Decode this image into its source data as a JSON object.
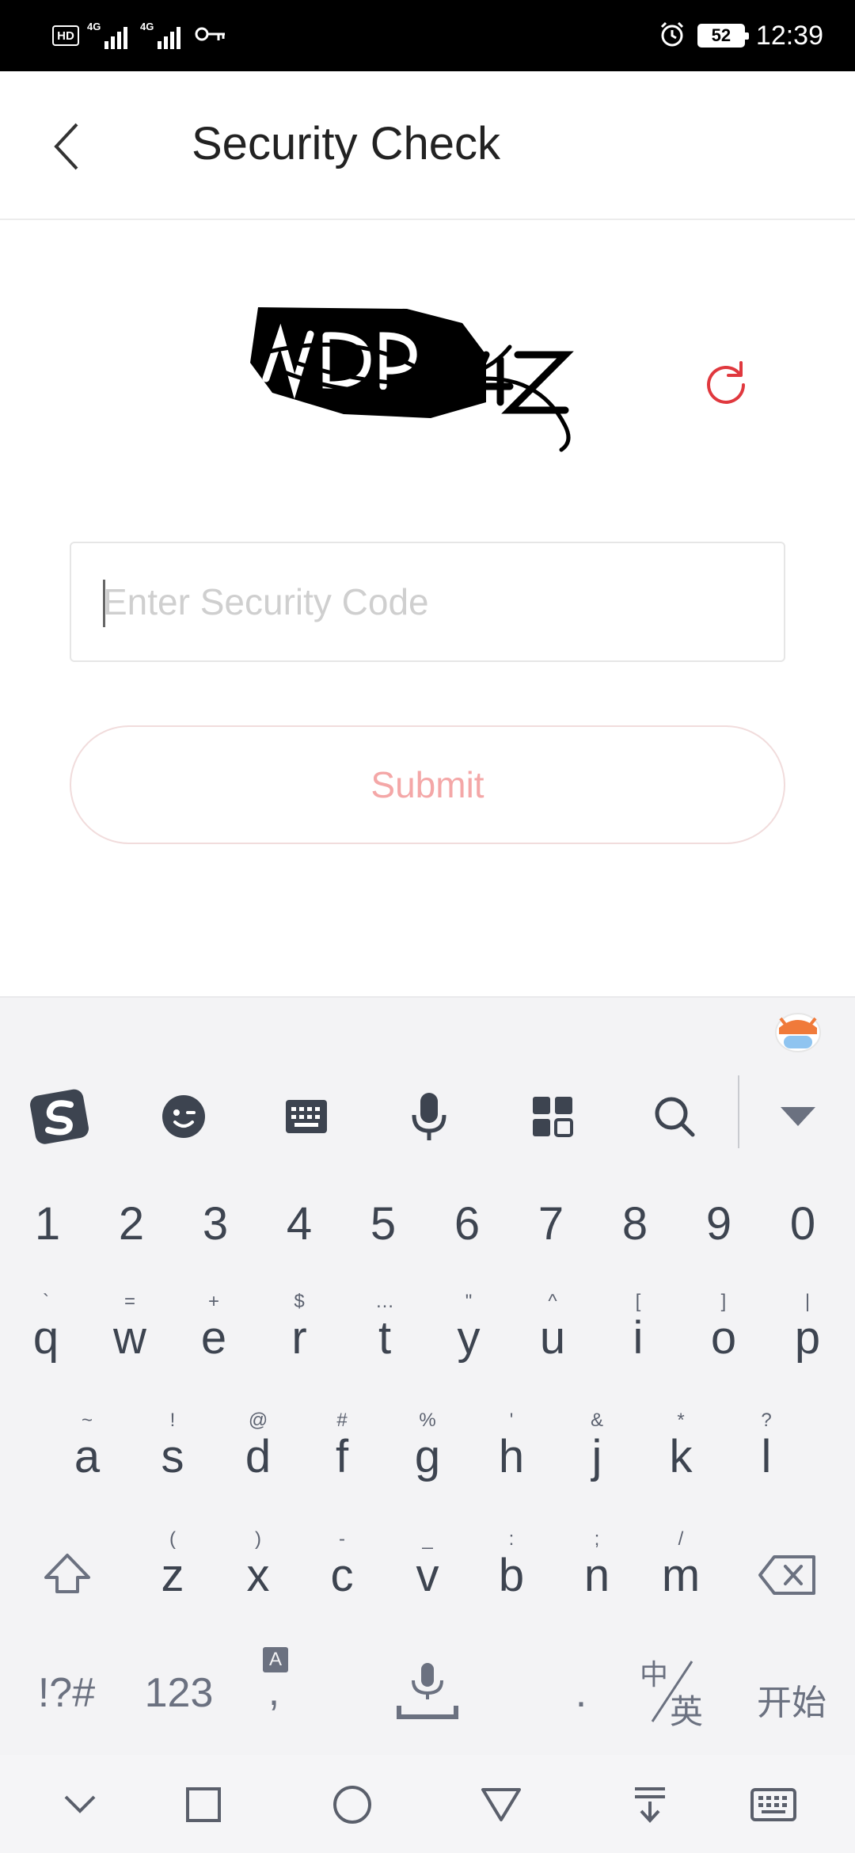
{
  "status_bar": {
    "hd_label": "HD",
    "signal1_label": "4G",
    "signal2_label": "4G",
    "key_icon": "key-icon",
    "alarm_icon": "alarm-icon",
    "battery_level": "52",
    "time": "12:39"
  },
  "header": {
    "back_icon": "chevron-left-icon",
    "title": "Security Check"
  },
  "captcha": {
    "image_text": "NDPK4Z",
    "refresh_icon": "refresh-icon",
    "accent_color": "#e0383e"
  },
  "form": {
    "input_value": "",
    "input_placeholder": "Enter Security Code",
    "submit_label": "Submit"
  },
  "keyboard": {
    "toolbar_icons": [
      "sogou-logo-icon",
      "emoji-icon",
      "keyboard-icon",
      "microphone-icon",
      "apps-grid-icon",
      "search-icon",
      "collapse-icon"
    ],
    "number_row": [
      "1",
      "2",
      "3",
      "4",
      "5",
      "6",
      "7",
      "8",
      "9",
      "0"
    ],
    "row1": [
      {
        "main": "q",
        "alt": "`"
      },
      {
        "main": "w",
        "alt": "="
      },
      {
        "main": "e",
        "alt": "+"
      },
      {
        "main": "r",
        "alt": "$"
      },
      {
        "main": "t",
        "alt": "…"
      },
      {
        "main": "y",
        "alt": "\""
      },
      {
        "main": "u",
        "alt": "^"
      },
      {
        "main": "i",
        "alt": "["
      },
      {
        "main": "o",
        "alt": "]"
      },
      {
        "main": "p",
        "alt": "|"
      }
    ],
    "row2": [
      {
        "main": "a",
        "alt": "~"
      },
      {
        "main": "s",
        "alt": "!"
      },
      {
        "main": "d",
        "alt": "@"
      },
      {
        "main": "f",
        "alt": "#"
      },
      {
        "main": "g",
        "alt": "%"
      },
      {
        "main": "h",
        "alt": "'"
      },
      {
        "main": "j",
        "alt": "&"
      },
      {
        "main": "k",
        "alt": "*"
      },
      {
        "main": "l",
        "alt": "?"
      }
    ],
    "row3": [
      {
        "main": "z",
        "alt": "("
      },
      {
        "main": "x",
        "alt": ")"
      },
      {
        "main": "c",
        "alt": "-"
      },
      {
        "main": "v",
        "alt": "_"
      },
      {
        "main": "b",
        "alt": ":"
      },
      {
        "main": "n",
        "alt": ";"
      },
      {
        "main": "m",
        "alt": "/"
      }
    ],
    "bottom_row": {
      "symbols": "!?#",
      "numbers": "123",
      "comma": ",",
      "comma_alt": "A",
      "period": ".",
      "lang_top": "中",
      "lang_bottom": "英",
      "action": "开始"
    },
    "shift_icon": "shift-icon",
    "backspace_icon": "backspace-icon",
    "space_icon": "space-mic-icon"
  },
  "navbar": {
    "icons": [
      "chevron-down-icon",
      "recents-square-icon",
      "home-circle-icon",
      "back-triangle-icon",
      "download-icon",
      "keyboard-icon"
    ]
  }
}
